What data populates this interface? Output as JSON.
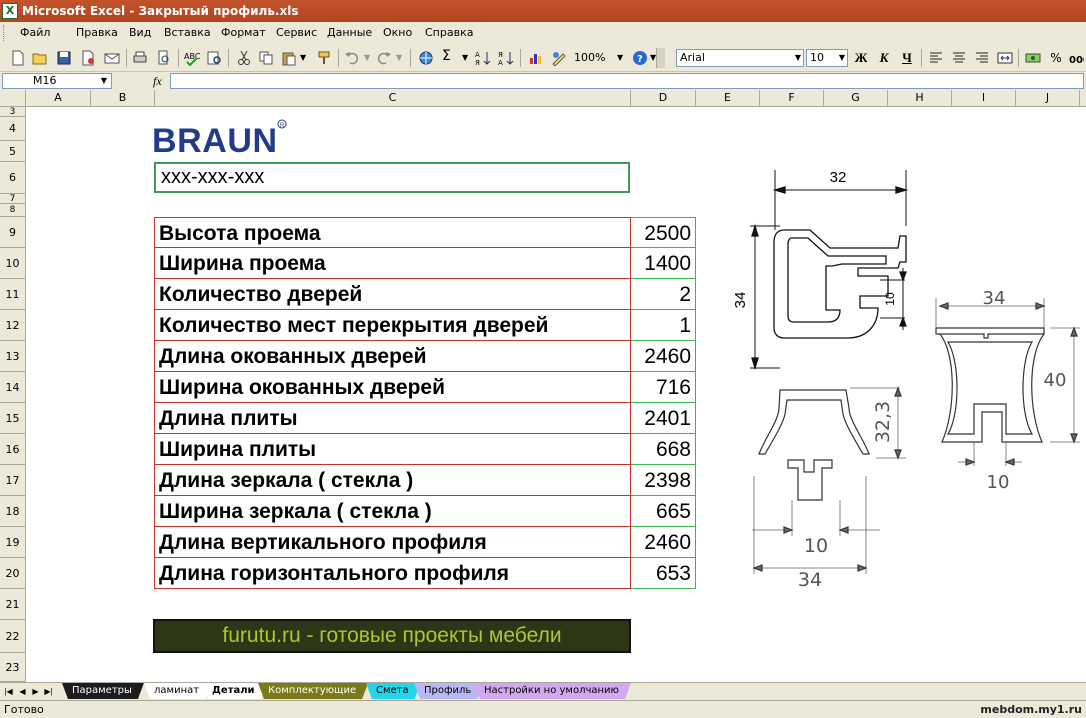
{
  "window": {
    "title": "Microsoft Excel - Закрытый профиль.xls"
  },
  "menu": [
    "Файл",
    "Правка",
    "Вид",
    "Вставка",
    "Формат",
    "Сервис",
    "Данные",
    "Окно",
    "Справка"
  ],
  "toolbar": {
    "zoom": "100%",
    "font_name": "Arial",
    "font_size": "10",
    "bold": "Ж",
    "italic": "К",
    "underline": "Ч",
    "percent": "%"
  },
  "formula_bar": {
    "name_box": "M16",
    "fx": "fx",
    "formula": ""
  },
  "columns": [
    "A",
    "B",
    "C",
    "D",
    "E",
    "F",
    "G",
    "H",
    "I",
    "J"
  ],
  "rows": [
    "3",
    "4",
    "5",
    "6",
    "7",
    "8",
    "9",
    "10",
    "11",
    "12",
    "13",
    "14",
    "15",
    "16",
    "17",
    "18",
    "19",
    "20",
    "21",
    "22",
    "23"
  ],
  "sheet": {
    "logo": "BRAUN",
    "name_cell": "ххх-ххх-ххх",
    "details": [
      {
        "label": "Высота проема",
        "value": "2500"
      },
      {
        "label": "Ширина проема",
        "value": "1400"
      },
      {
        "label": "Количество дверей",
        "value": "2"
      },
      {
        "label": "Количество мест перекрытия дверей",
        "value": "1"
      },
      {
        "label": "Длина окованных дверей",
        "value": "2460"
      },
      {
        "label": "Ширина окованных дверей",
        "value": "716"
      },
      {
        "label": "Длина плиты",
        "value": "2401"
      },
      {
        "label": "Ширина плиты",
        "value": "668"
      },
      {
        "label": "Длина зеркала ( стекла )",
        "value": "2398"
      },
      {
        "label": "Ширина зеркала ( стекла )",
        "value": "665"
      },
      {
        "label": "Длина вертикального профиля",
        "value": "2460"
      },
      {
        "label": "Длина горизонтального профиля",
        "value": "653"
      }
    ],
    "banner": "furutu.ru - готовые проекты мебели",
    "drawing_dims": {
      "d1_width": "32",
      "d1_height": "34",
      "d1_slot": "10",
      "d2_height": "32,3",
      "d2_slot": "10",
      "d2_width": "34",
      "d3_width": "34",
      "d3_height": "40",
      "d3_slot": "10"
    }
  },
  "tabs": [
    {
      "label": "Параметры",
      "color": "#1c1c1c",
      "text_color": "#ffffff"
    },
    {
      "label": "ламинат",
      "color": "#ffffff",
      "text_color": "#000000"
    },
    {
      "label": "Детали",
      "color": "#ffffff",
      "text_color": "#000000",
      "active": true
    },
    {
      "label": "Комплектующие",
      "color": "#7a7a1a",
      "text_color": "#ffffff"
    },
    {
      "label": "Смета",
      "color": "#26d4e8",
      "text_color": "#000000"
    },
    {
      "label": "Профиль",
      "color": "#b8b8f5",
      "text_color": "#000000"
    },
    {
      "label": "Настройки но умолчанию",
      "color": "#d2a8ee",
      "text_color": "#000000"
    }
  ],
  "status": {
    "text": "Готово",
    "watermark": "mebdom.my1.ru"
  }
}
